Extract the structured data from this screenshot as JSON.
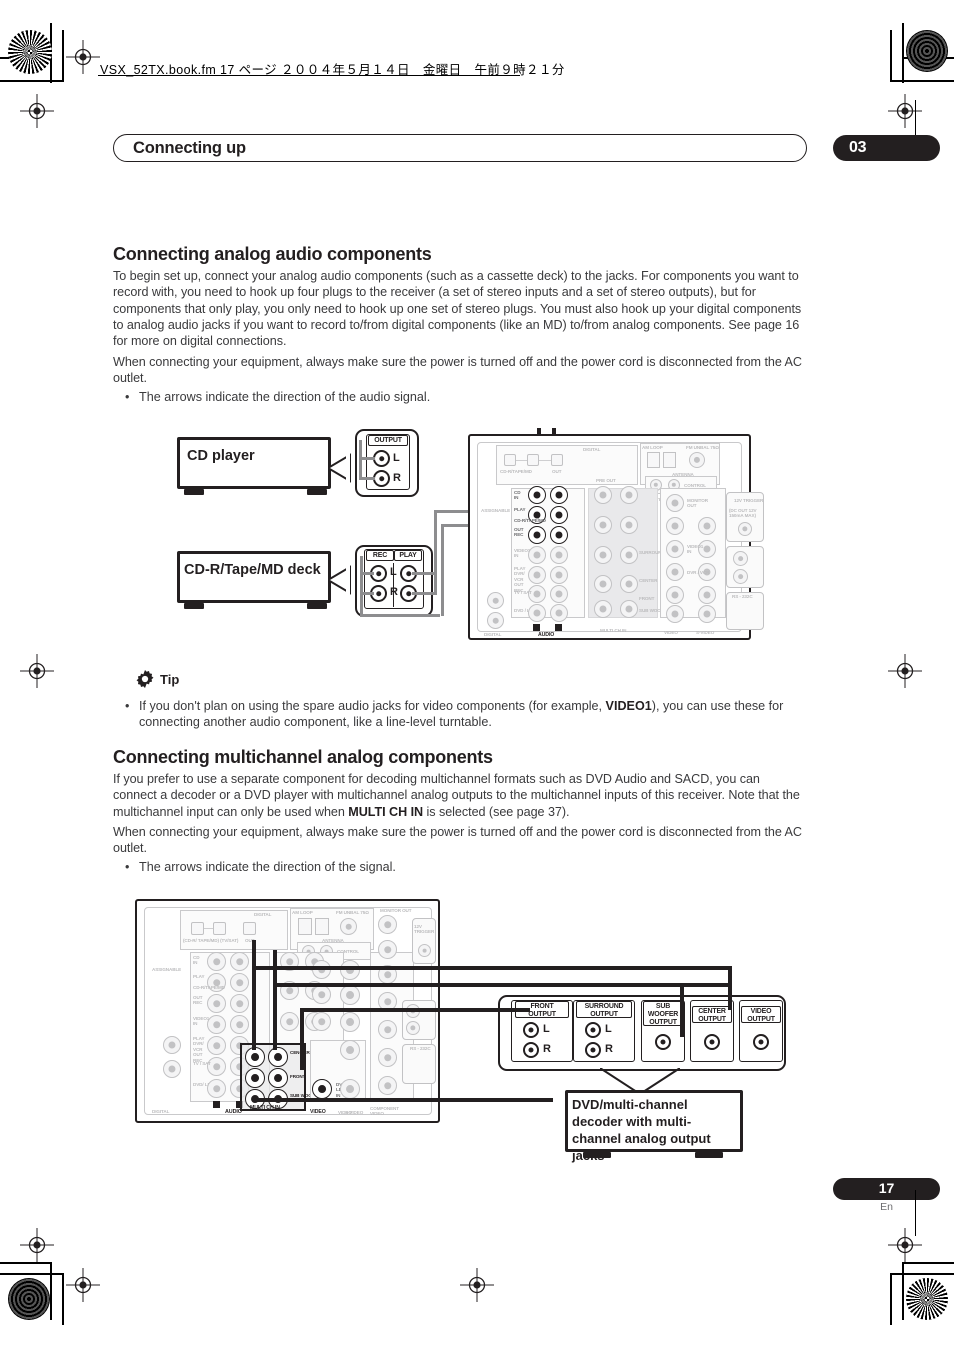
{
  "print_marks": {
    "header_note": "VSX_52TX.book.fm 17 ページ ２００４年５月１４日　金曜日　午前９時２１分"
  },
  "running_head": {
    "title": "Connecting up",
    "chapter": "03"
  },
  "sections": [
    {
      "heading": "Connecting analog audio components",
      "paragraphs": [
        "To begin set up, connect your analog audio components (such as a cassette deck) to the jacks. For components you want to record with, you need to hook up four plugs to the receiver (a set of stereo inputs and a set of stereo outputs), but for components that only play, you only need to hook up one set of stereo plugs. You must also hook up your digital components to analog audio jacks if you want to record to/from digital components (like an MD) to/from analog components. See page 16 for more on digital connections.",
        "When connecting your equipment, always make sure the power is turned off and the power cord is disconnected from the AC outlet."
      ],
      "bullet": "The arrows indicate the direction of the audio signal."
    },
    {
      "heading": "Connecting multichannel analog components",
      "paragraph_pre": "If you prefer to use a separate component for decoding multichannel formats such as DVD Audio and SACD, you can connect a decoder or a DVD player with multichannel analog outputs to the multichannel inputs of this receiver. Note that the multichannel input can only be used when ",
      "paragraph_bold": "MULTI CH IN",
      "paragraph_post": " is selected (see page 37).",
      "paragraph2": "When connecting your equipment, always make sure the power is turned off and the power cord is disconnected from the AC outlet.",
      "bullet": "The arrows indicate the direction of the signal."
    }
  ],
  "tip": {
    "label": "Tip",
    "icon": "gear-icon",
    "text_pre": "If you don't plan on using the spare audio jacks for video components (for example, ",
    "text_bold": "VIDEO1",
    "text_post": "), you can use these for connecting another audio component, like a line-level turntable."
  },
  "diagram1": {
    "devices": [
      {
        "name": "cd-player",
        "label": "CD player"
      },
      {
        "name": "cdr-tape-md-deck",
        "label": "CD-R/Tape/MD deck"
      }
    ],
    "cd_panel": {
      "caption": "OUTPUT",
      "jacks": [
        {
          "label": "L"
        },
        {
          "label": "R"
        }
      ]
    },
    "deck_panel": {
      "captions": [
        "REC",
        "PLAY"
      ],
      "jacks": [
        {
          "label": "L"
        },
        {
          "label": "R"
        }
      ]
    },
    "arrows": [
      {
        "dir": "right"
      },
      {
        "dir": "right"
      },
      {
        "dir": "left"
      }
    ],
    "receiver_labels": {
      "digital": "DIGITAL",
      "audio": "AUDIO",
      "video": "VIDEO",
      "svideo": "S-VIDEO",
      "component_video": "COMPONENT VIDEO",
      "monitor_out": "MONITOR OUT",
      "am_loop": "AM LOOP",
      "fm_unbal": "FM UNBAL 75Ω",
      "antenna": "ANTENNA",
      "control": "CONTROL",
      "multiroom": "MULTI-ROOM & SOURCE",
      "trigger": "12V TRIGGER",
      "trigger_sub": "(DC OUT 12V 150mA MAX)",
      "rs232c": "RS - 232C",
      "multi_ch_in": "MULTI CH IN",
      "assignable": "ASSIGNABLE",
      "in": "IN",
      "out": "OUT",
      "cd_in": "CD IN",
      "play": "PLAY",
      "rec": "REC",
      "cdr_tape_md": "CD-R/TAPE/MD",
      "video1": "VIDEO1",
      "dvr_vcr": "DVR / VCR",
      "tv_sat": "TV / SAT",
      "dvd_ld": "DVD / LD",
      "center": "CENTER",
      "front": "FRONT",
      "sub_woofer": "SUB WOOFER",
      "surround": "SURROUND",
      "surround_back": "SURROUND BACK",
      "pre_out": "PRE OUT"
    }
  },
  "diagram2": {
    "output_panels": [
      {
        "name": "front-output",
        "caption": "FRONT OUTPUT",
        "jacks": [
          "L",
          "R"
        ]
      },
      {
        "name": "surround-output",
        "caption": "SURROUND OUTPUT",
        "jacks": [
          "L",
          "R"
        ]
      },
      {
        "name": "sub-woofer-output",
        "caption": "SUB WOOFER OUTPUT",
        "jacks": []
      },
      {
        "name": "center-output",
        "caption": "CENTER OUTPUT",
        "jacks": []
      },
      {
        "name": "video-output",
        "caption": "VIDEO OUTPUT",
        "jacks": []
      }
    ],
    "caption_box": "DVD/multi-channel decoder with multi-channel analog output jacks",
    "arrows": [
      {
        "dir": "left"
      },
      {
        "dir": "left"
      },
      {
        "dir": "left"
      },
      {
        "dir": "left"
      },
      {
        "dir": "left"
      }
    ],
    "receiver_labels": {
      "multi_ch_in": "MULTI CH IN",
      "audio": "AUDIO",
      "video": "VIDEO",
      "digital": "DIGITAL",
      "center": "CEN-TER",
      "front": "FRONT",
      "sub_woofer": "SUB WOOFER",
      "dvd_ld_in": "DVD/ LD IN"
    }
  },
  "footer": {
    "page": "17",
    "lang": "En"
  }
}
